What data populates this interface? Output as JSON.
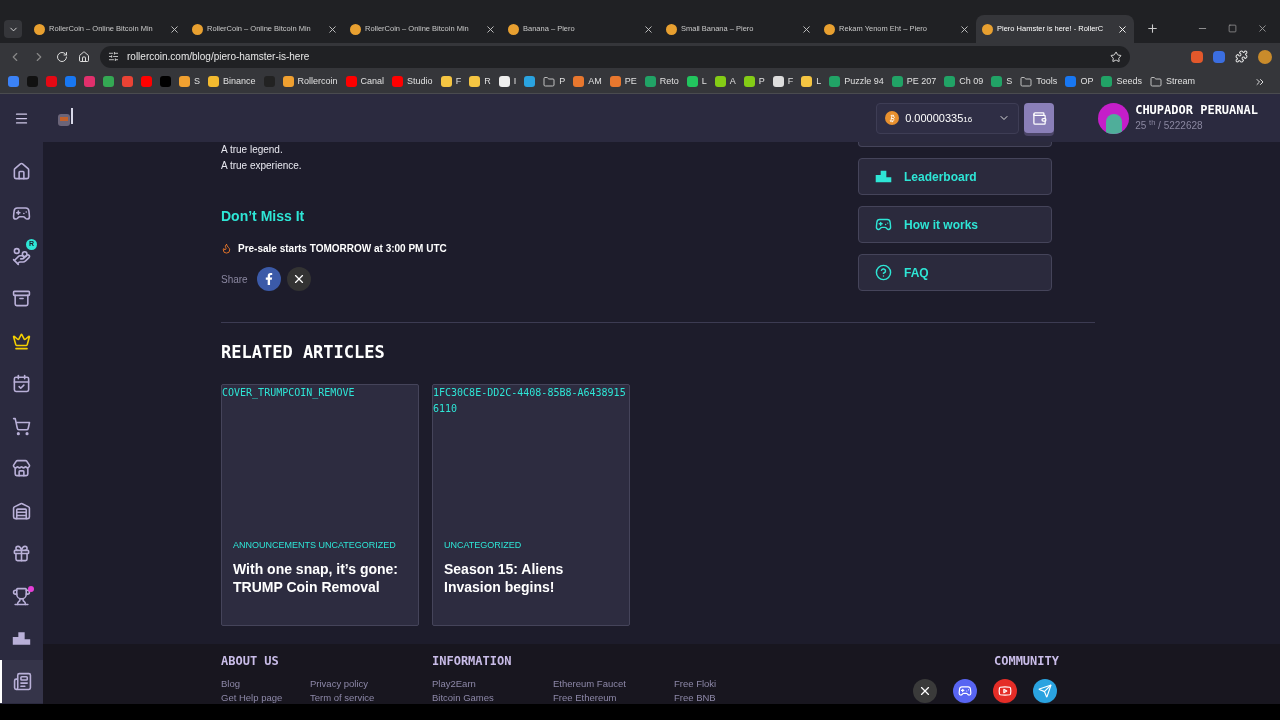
{
  "browser": {
    "tabs": [
      {
        "label": "RollerCoin – Online Bitcoin Min",
        "selected": false
      },
      {
        "label": "RollerCoin – Online Bitcoin Min",
        "selected": false
      },
      {
        "label": "RollerCoin – Online Bitcoin Min",
        "selected": false
      },
      {
        "label": "Banana – Piero",
        "selected": false
      },
      {
        "label": "Small Banana – Piero",
        "selected": false
      },
      {
        "label": "Rekam Yenom Eht – Piero",
        "selected": false
      },
      {
        "label": "Piero Hamster is here! - RollerC",
        "selected": true
      }
    ],
    "address": "rollercoin.com/blog/piero-hamster-is-here",
    "bookmarks": [
      {
        "kind": "site",
        "color": "#3b82f6"
      },
      {
        "kind": "site",
        "color": "#111111"
      },
      {
        "kind": "site",
        "color": "#e50914"
      },
      {
        "kind": "site",
        "color": "#1877f2"
      },
      {
        "kind": "site",
        "color": "#e1306c"
      },
      {
        "kind": "site",
        "color": "#34a853"
      },
      {
        "kind": "site",
        "color": "#ea4335"
      },
      {
        "kind": "site",
        "color": "#ff0000"
      },
      {
        "kind": "site",
        "color": "#000000"
      },
      {
        "kind": "site",
        "color": "#f0a030",
        "label": "S"
      },
      {
        "kind": "site",
        "color": "#f3ba2f",
        "label": "Binance"
      },
      {
        "kind": "site",
        "color": "#222222"
      },
      {
        "kind": "site",
        "color": "#f0a030",
        "label": "Rollercoin"
      },
      {
        "kind": "site",
        "color": "#ff0000",
        "label": "Canal"
      },
      {
        "kind": "site",
        "color": "#ff0000",
        "label": "Studio"
      },
      {
        "kind": "site",
        "color": "#f5c542",
        "label": "F"
      },
      {
        "kind": "site",
        "color": "#f5c542",
        "label": "R"
      },
      {
        "kind": "site",
        "color": "#eeeeee",
        "label": "I"
      },
      {
        "kind": "site",
        "color": "#2aa3e0"
      },
      {
        "kind": "folder",
        "label": "P"
      },
      {
        "kind": "site",
        "color": "#e8772e",
        "label": "AM"
      },
      {
        "kind": "site",
        "color": "#e8772e",
        "label": "PE"
      },
      {
        "kind": "site",
        "color": "#21a366",
        "label": "Reto"
      },
      {
        "kind": "site",
        "color": "#22c55e",
        "label": "L"
      },
      {
        "kind": "site",
        "color": "#84cc16",
        "label": "A"
      },
      {
        "kind": "site",
        "color": "#84cc16",
        "label": "P"
      },
      {
        "kind": "site",
        "color": "#dddddd",
        "label": "F"
      },
      {
        "kind": "site",
        "color": "#f5c542",
        "label": "L"
      },
      {
        "kind": "site",
        "color": "#21a366",
        "label": "Puzzle 94"
      },
      {
        "kind": "site",
        "color": "#21a366",
        "label": "PE 207"
      },
      {
        "kind": "site",
        "color": "#21a366",
        "label": "Ch 09"
      },
      {
        "kind": "site",
        "color": "#21a366",
        "label": "S"
      },
      {
        "kind": "folder",
        "label": "Tools"
      },
      {
        "kind": "site",
        "color": "#1877f2",
        "label": "OP"
      },
      {
        "kind": "site",
        "color": "#21a366",
        "label": "Seeds"
      },
      {
        "kind": "folder",
        "label": "Stream"
      }
    ]
  },
  "header": {
    "balance": "0.00000335",
    "balance_small": "16",
    "user_name": "CHUPADOR PERUANAL",
    "rank": "25 $^{th}$ / 5222628"
  },
  "sidebar": {
    "items": [
      {
        "kind": "home",
        "selected": false,
        "notification": false
      },
      {
        "kind": "games",
        "selected": false,
        "notification": false
      },
      {
        "kind": "referral",
        "selected": false,
        "notification": false,
        "badge": "R"
      },
      {
        "kind": "chest",
        "selected": false,
        "notification": false
      },
      {
        "kind": "crown",
        "selected": false,
        "notification": false
      },
      {
        "kind": "tasks",
        "selected": false,
        "notification": false
      },
      {
        "kind": "cart",
        "selected": false,
        "notification": false
      },
      {
        "kind": "store",
        "selected": false,
        "notification": false
      },
      {
        "kind": "warehouse",
        "selected": false,
        "notification": false
      },
      {
        "kind": "gift",
        "selected": false,
        "notification": false
      },
      {
        "kind": "trophy",
        "selected": false,
        "notification": true
      },
      {
        "kind": "podium",
        "selected": false,
        "notification": false
      },
      {
        "kind": "blog",
        "selected": true,
        "notification": false
      }
    ]
  },
  "article": {
    "lines": [
      "A true legend.",
      "A true experience."
    ],
    "heading": "Don’t Miss It",
    "announcement": "Pre-sale starts TOMORROW at 3:00 PM UTC",
    "share_label": "Share"
  },
  "side_links": [
    {
      "kind": "podium",
      "label": "Leaderboard"
    },
    {
      "kind": "games",
      "label": "How it works"
    },
    {
      "kind": "faq",
      "label": "FAQ"
    }
  ],
  "related": {
    "title": "RELATED ARTICLES",
    "cards": [
      {
        "image_alt": "COVER_TRUMPCOIN_REMOVE",
        "categories": "ANNOUNCEMENTS UNCATEGORIZED",
        "title": "With one snap, it’s gone: TRUMP Coin Removal"
      },
      {
        "image_alt": "1FC30C8E-DD2C-4408-85B8-A64389156110",
        "categories": "UNCATEGORIZED",
        "title": "Season 15: Aliens Invasion begins!"
      }
    ]
  },
  "footer": {
    "about": {
      "title": "ABOUT US",
      "columns": [
        [
          "Blog",
          "Get Help page"
        ],
        [
          "Privacy policy",
          "Term of service"
        ]
      ]
    },
    "information": {
      "title": "INFORMATION",
      "columns": [
        [
          "Play2Earn",
          "Bitcoin Games"
        ],
        [
          "Ethereum Faucet",
          "Free Ethereum"
        ],
        [
          "Free Floki",
          "Free BNB"
        ]
      ]
    },
    "community": {
      "title": "COMMUNITY",
      "links": [
        {
          "kind": "x",
          "color": "#3a3a3a"
        },
        {
          "kind": "discord",
          "color": "#5865f2"
        },
        {
          "kind": "youtube",
          "color": "#e52d27"
        },
        {
          "kind": "telegram",
          "color": "#2aa3e0"
        }
      ]
    }
  }
}
